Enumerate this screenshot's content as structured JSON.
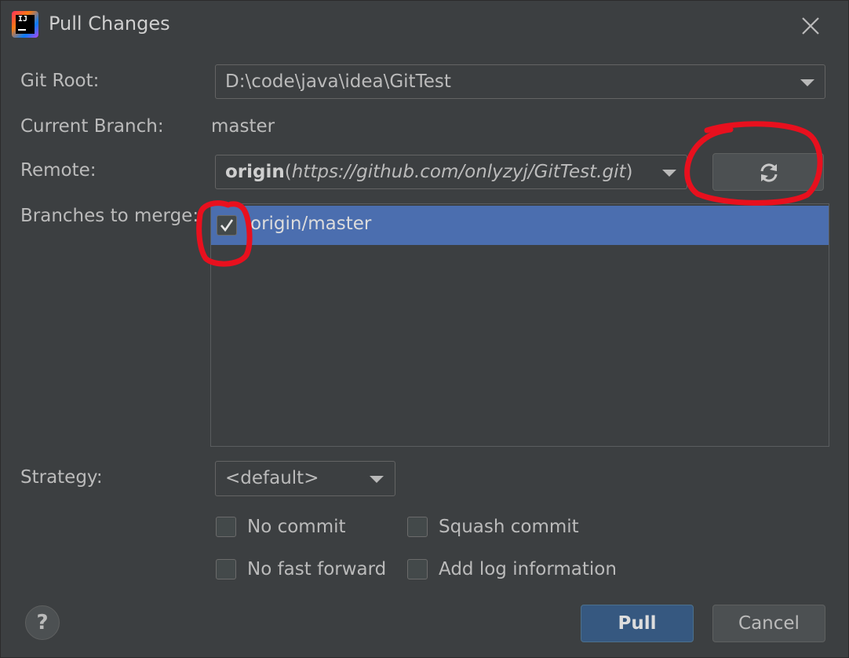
{
  "window": {
    "title": "Pull Changes"
  },
  "git_root": {
    "label": "Git Root:",
    "value": "D:\\code\\java\\idea\\GitTest"
  },
  "current_branch": {
    "label": "Current Branch:",
    "value": "master"
  },
  "remote": {
    "label": "Remote:",
    "name": "origin",
    "open_paren": "(",
    "url": "https://github.com/onlyzyj/GitTest.git",
    "close_paren": ")"
  },
  "branches": {
    "label": "Branches to merge:",
    "items": [
      {
        "label": "origin/master",
        "checked": true,
        "selected": true
      }
    ]
  },
  "strategy": {
    "label": "Strategy:",
    "value": "<default>"
  },
  "options": {
    "no_commit": "No commit",
    "squash_commit": "Squash commit",
    "no_fast_forward": "No fast forward",
    "add_log_information": "Add log information"
  },
  "help": {
    "label": "?"
  },
  "buttons": {
    "pull": "Pull",
    "cancel": "Cancel"
  },
  "colors": {
    "background": "#3c3f41",
    "selection": "#4b6eaf",
    "primary_button": "#365880",
    "annotation": "#e8101e"
  },
  "icons": {
    "app": "intellij-idea-icon",
    "close": "close-icon",
    "refresh": "refresh-icon",
    "dropdown": "chevron-down-icon",
    "check": "checkmark-icon"
  }
}
